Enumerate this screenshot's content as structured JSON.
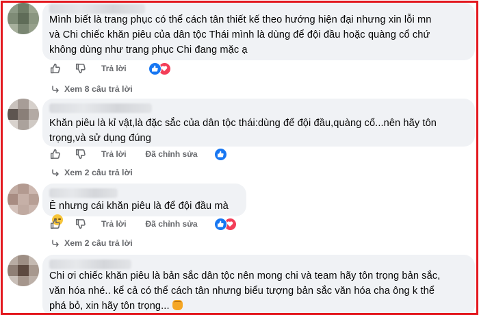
{
  "comments": [
    {
      "text": "Mình biết là trang phục có thể cách tân thiết kế theo hướng hiện đại nhưng xin lỗi mn\nvà Chi chiếc khăn piêu của dân tộc Thái mình là dùng để đội đầu hoặc quàng cổ chứ\nkhông dùng như trang phục Chi đang mặc ạ",
      "reply_label": "Trả lời",
      "reactions": [
        "like",
        "love"
      ],
      "replies_label": "Xem 8 câu trả lời"
    },
    {
      "text": "Khăn piêu là kỉ vật,là đặc sắc của dân tộc thái:dùng để đội đầu,quàng cổ...nên hãy tôn\ntrọng,và sử dụng đúng",
      "reply_label": "Trả lời",
      "edited_label": "Đã chỉnh sửa",
      "reactions": [
        "like"
      ],
      "replies_label": "Xem 2 câu trả lời"
    },
    {
      "text": "Ê nhưng cái khăn piêu là để đội đầu mà",
      "emoji": "pensive-face",
      "reply_label": "Trả lời",
      "edited_label": "Đã chỉnh sửa",
      "reactions": [
        "like",
        "love"
      ],
      "replies_label": "Xem 2 câu trả lời"
    },
    {
      "text": "Chi ơi chiếc khăn piêu là bản sắc dân tộc nên mong chi và team hãy tôn trọng bản sắc,\nvăn hóa nhé.. kể cả có thể cách tân nhưng biểu tượng bản sắc văn hóa cha ông k thể\nphá bỏ, xin hãy tôn trọng...",
      "emoji": "raised-fist"
    }
  ],
  "colors": {
    "frame": "#e3171d",
    "bubble": "#f0f2f5",
    "muted_text": "#65676b",
    "like_blue": "#1877f2",
    "love_red": "#f33e58"
  }
}
